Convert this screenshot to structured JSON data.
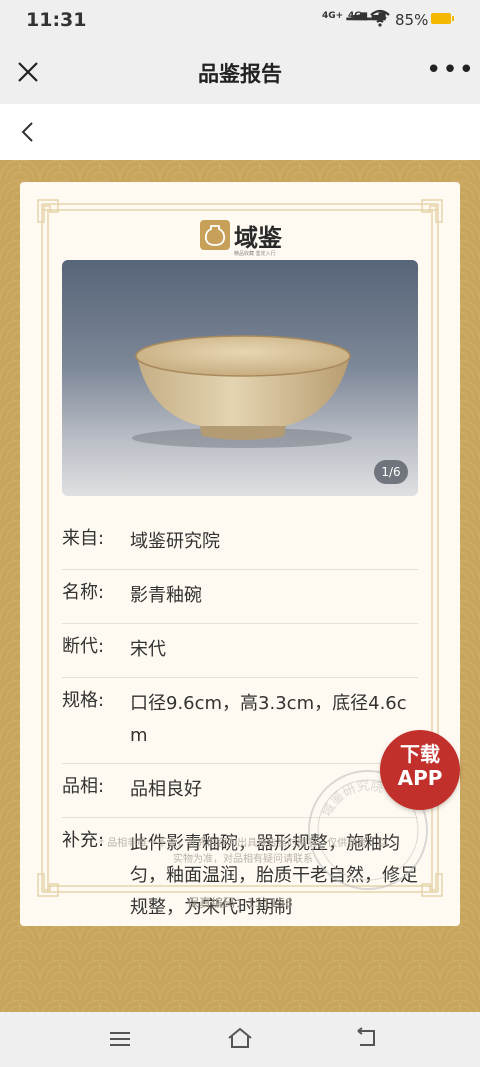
{
  "status": {
    "time": "11:31",
    "signal1": "4G+",
    "signal2": "4G",
    "battery": "85%"
  },
  "header": {
    "title": "品鉴报告"
  },
  "card": {
    "brand": "域鉴",
    "brand_sub": "精品收藏 鉴定入行",
    "photo_counter": "1/6",
    "rows": [
      {
        "label": "来自:",
        "value": "域鉴研究院"
      },
      {
        "label": "名称:",
        "value": "影青釉碗"
      },
      {
        "label": "断代:",
        "value": "宋代"
      },
      {
        "label": "规格:",
        "value": "口径9.6cm，高3.3cm，底径4.6cm"
      },
      {
        "label": "品相:",
        "value": "品相良好"
      },
      {
        "label": "补充:",
        "value": "此件影青釉碗，器形规整，施釉均匀，釉面温润，胎质干老自然，修足规整，为宋代时期制"
      }
    ],
    "note": "* 品相非唯一不变，补充内容为出具报告当时情况，仅供参考。以实物为准，对品相有疑问请联系",
    "serial": "保真编码：151158",
    "seal_text": "域鉴研究院"
  },
  "download": {
    "line1": "下载",
    "line2": "APP"
  },
  "colors": {
    "gold": "#c8a55d",
    "card": "#fffaf1",
    "download": "#c1302b"
  }
}
